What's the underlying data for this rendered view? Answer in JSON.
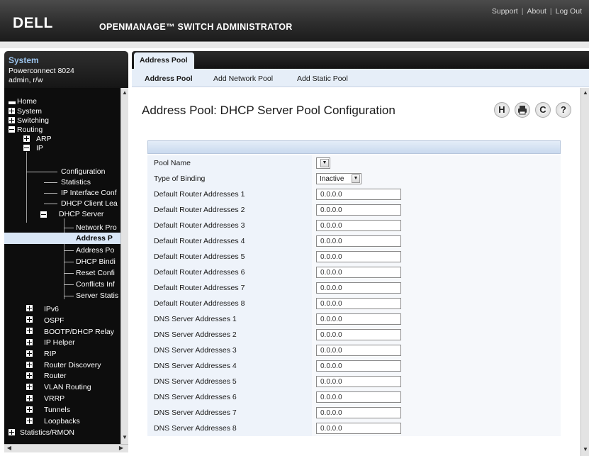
{
  "header": {
    "logo_text": "DELL",
    "app_title": "OPENMANAGE™ SWITCH ADMINISTRATOR",
    "links": [
      "Support",
      "About",
      "Log Out"
    ],
    "separator": "|"
  },
  "system": {
    "title": "System",
    "model": "Powerconnect 8024",
    "user": "admin, r/w"
  },
  "tree": {
    "home": "Home",
    "system": "System",
    "switching": "Switching",
    "routing": "Routing",
    "arp": "ARP",
    "ip": "IP",
    "configuration": "Configuration",
    "statistics": "Statistics",
    "ip_interface_conf": "IP Interface Conf",
    "dhcp_client_lea": "DHCP Client Lea",
    "dhcp_server": "DHCP Server",
    "network_pro": "Network Pro",
    "address_p": "Address P",
    "address_po": "Address Po",
    "dhcp_bindi": "DHCP Bindi",
    "reset_confi": "Reset Confi",
    "conflicts_inf": "Conflicts Inf",
    "server_statis": "Server Statis",
    "ipv6": "IPv6",
    "ospf": "OSPF",
    "bootp_relay": "BOOTP/DHCP Relay",
    "ip_helper": "IP Helper",
    "rip": "RIP",
    "router_discovery": "Router Discovery",
    "router": "Router",
    "vlan_routing": "VLAN Routing",
    "vrrp": "VRRP",
    "tunnels": "Tunnels",
    "loopbacks": "Loopbacks",
    "statistics_rmon": "Statistics/RMON"
  },
  "tabs": {
    "main": "Address Pool",
    "sub": [
      "Address Pool",
      "Add Network Pool",
      "Add Static Pool"
    ]
  },
  "page": {
    "title": "Address Pool: DHCP Server Pool Configuration"
  },
  "toolbar_icons": [
    "save-icon",
    "print-icon",
    "refresh-icon",
    "help-icon"
  ],
  "form": {
    "pool_name_label": "Pool Name",
    "pool_name_value": "",
    "binding_label": "Type of Binding",
    "binding_value": "Inactive",
    "rows": [
      {
        "label": "Default Router Addresses 1",
        "value": "0.0.0.0"
      },
      {
        "label": "Default Router Addresses 2",
        "value": "0.0.0.0"
      },
      {
        "label": "Default Router Addresses 3",
        "value": "0.0.0.0"
      },
      {
        "label": "Default Router Addresses 4",
        "value": "0.0.0.0"
      },
      {
        "label": "Default Router Addresses 5",
        "value": "0.0.0.0"
      },
      {
        "label": "Default Router Addresses 6",
        "value": "0.0.0.0"
      },
      {
        "label": "Default Router Addresses 7",
        "value": "0.0.0.0"
      },
      {
        "label": "Default Router Addresses 8",
        "value": "0.0.0.0"
      },
      {
        "label": "DNS Server Addresses 1",
        "value": "0.0.0.0"
      },
      {
        "label": "DNS Server Addresses 2",
        "value": "0.0.0.0"
      },
      {
        "label": "DNS Server Addresses 3",
        "value": "0.0.0.0"
      },
      {
        "label": "DNS Server Addresses 4",
        "value": "0.0.0.0"
      },
      {
        "label": "DNS Server Addresses 5",
        "value": "0.0.0.0"
      },
      {
        "label": "DNS Server Addresses 6",
        "value": "0.0.0.0"
      },
      {
        "label": "DNS Server Addresses 7",
        "value": "0.0.0.0"
      },
      {
        "label": "DNS Server Addresses 8",
        "value": "0.0.0.0"
      }
    ]
  },
  "colors": {
    "banner": "#2e2e2e",
    "tree_bg": "#0d0d0d",
    "system_title": "#9bc3ec",
    "tab_bg": "#e6eef8",
    "label_cell": "#eef3fa"
  }
}
